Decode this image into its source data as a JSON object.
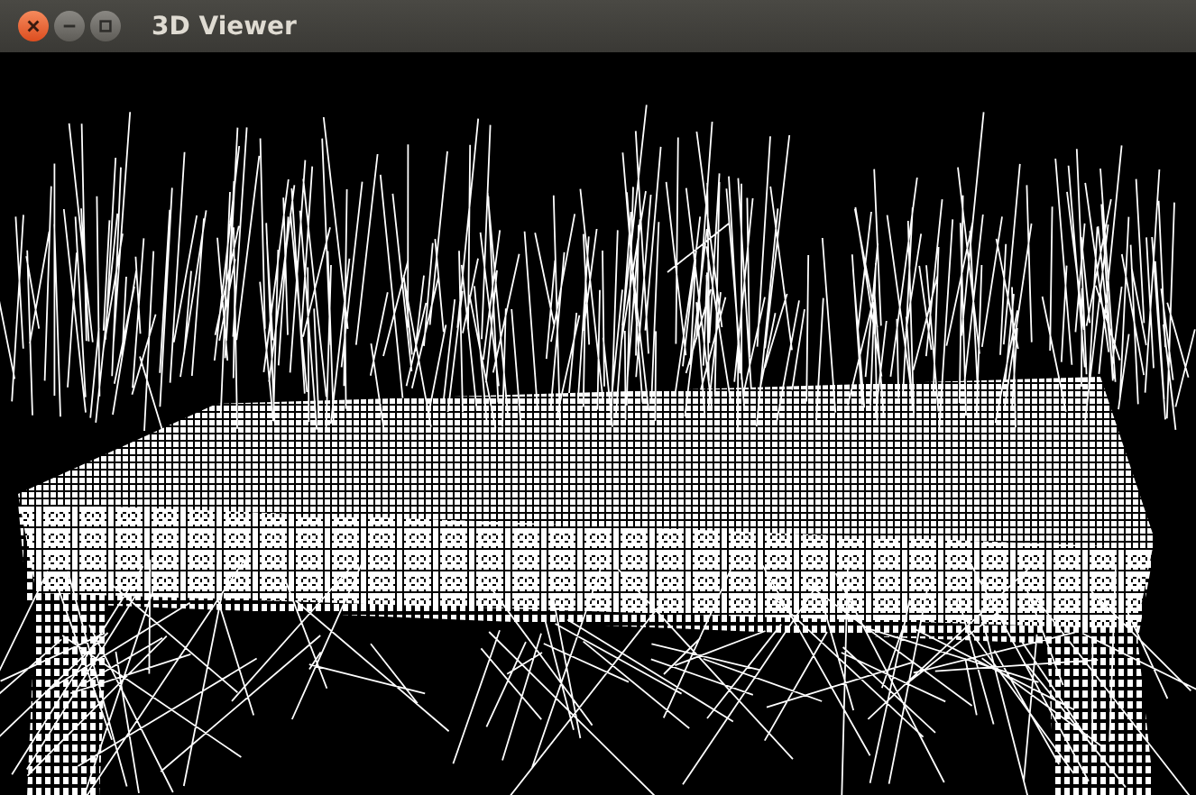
{
  "window": {
    "title": "3D Viewer",
    "buttons": [
      {
        "kind": "close"
      },
      {
        "kind": "minimize"
      },
      {
        "kind": "maximize"
      }
    ]
  }
}
